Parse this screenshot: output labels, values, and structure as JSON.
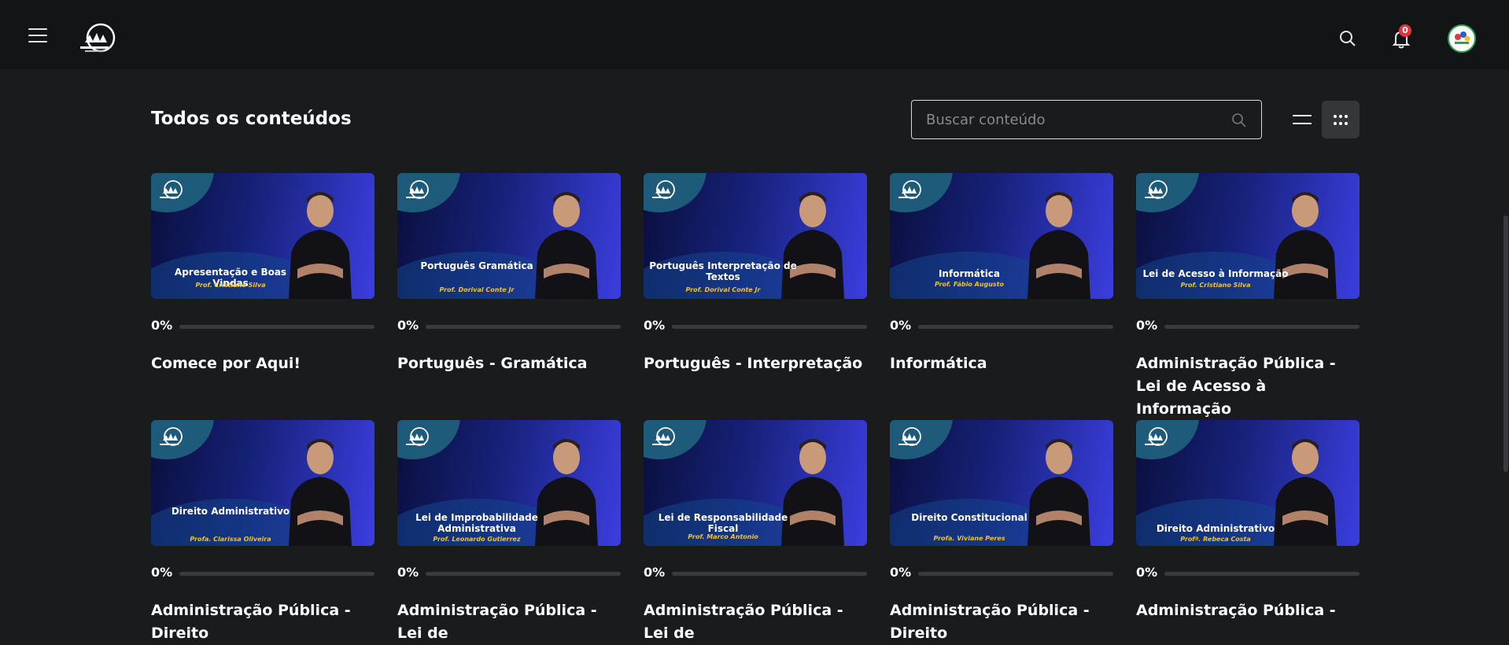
{
  "header": {
    "notifications_count": "0",
    "logo_alt": "Vencendo Concursos"
  },
  "main": {
    "title": "Todos os conteúdos",
    "search": {
      "placeholder": "Buscar conteúdo"
    }
  },
  "colors": {
    "accent": "#3b3ee0",
    "badge": "#e5343c",
    "prof_text": "#f4c21a",
    "background": "#1a1b1d"
  },
  "cards": [
    {
      "thumb_title": "Apresentação e Boas Vindas",
      "thumb_prof": "Prof. Cristiano Silva",
      "progress_label": "0%",
      "progress": 0,
      "title": "Comece por Aqui!"
    },
    {
      "thumb_title": "Português Gramática",
      "thumb_prof": "Prof. Dorival Conte Jr",
      "progress_label": "0%",
      "progress": 0,
      "title": "Português - Gramática"
    },
    {
      "thumb_title": "Português Interpretação de Textos",
      "thumb_prof": "Prof. Dorival Conte Jr",
      "progress_label": "0%",
      "progress": 0,
      "title": "Português - Interpretação"
    },
    {
      "thumb_title": "Informática",
      "thumb_prof": "Prof. Fábio Augusto",
      "progress_label": "0%",
      "progress": 0,
      "title": "Informática"
    },
    {
      "thumb_title": "Lei de Acesso à Informação",
      "thumb_prof": "Prof. Cristiano Silva",
      "progress_label": "0%",
      "progress": 0,
      "title": "Administração Pública - Lei de Acesso à Informação"
    },
    {
      "thumb_title": "Direito Administrativo",
      "thumb_prof": "Profa. Clarissa Oliveira",
      "progress_label": "0%",
      "progress": 0,
      "title": "Administração Pública - Direito"
    },
    {
      "thumb_title": "Lei de Improbabilidade Administrativa",
      "thumb_prof": "Prof. Leonardo Gutierrez",
      "progress_label": "0%",
      "progress": 0,
      "title": "Administração Pública - Lei de"
    },
    {
      "thumb_title": "Lei de Responsabilidade Fiscal",
      "thumb_prof": "Prof. Marco Antonio",
      "progress_label": "0%",
      "progress": 0,
      "title": "Administração Pública - Lei de"
    },
    {
      "thumb_title": "Direito Constitucional",
      "thumb_prof": "Profa. Viviane Peres",
      "progress_label": "0%",
      "progress": 0,
      "title": "Administração Pública - Direito"
    },
    {
      "thumb_title": "Direito Administrativo",
      "thumb_prof": "Profª. Rebeca Costa",
      "progress_label": "0%",
      "progress": 0,
      "title": "Administração Pública -"
    }
  ]
}
